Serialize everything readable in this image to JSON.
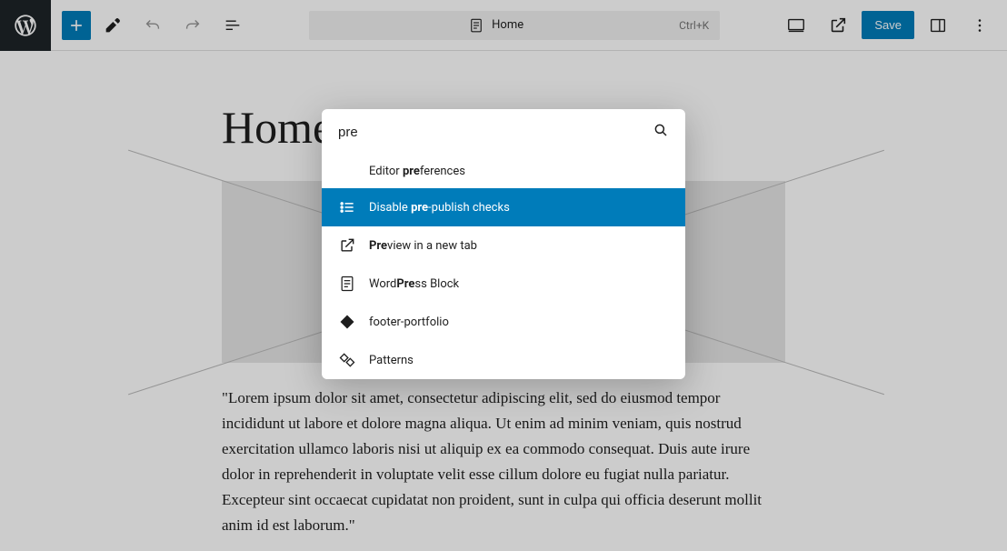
{
  "header": {
    "doc_title": "Home",
    "shortcut": "Ctrl+K",
    "save_label": "Save"
  },
  "page": {
    "title": "Home",
    "body": "\"Lorem ipsum dolor sit amet, consectetur adipiscing elit, sed do eiusmod tempor incididunt ut labore et dolore magna aliqua. Ut enim ad minim veniam, quis nostrud exercitation ullamco laboris nisi ut aliquip ex ea commodo consequat. Duis aute irure dolor in reprehenderit in voluptate velit esse cillum dolore eu fugiat nulla pariatur. Excepteur sint occaecat cupidatat non proident, sunt in culpa qui officia deserunt mollit anim id est laborum.\""
  },
  "palette": {
    "query": "pre",
    "items": [
      {
        "pre": "Editor ",
        "bold": "pre",
        "post": "ferences"
      },
      {
        "pre": "Disable ",
        "bold": "pre",
        "post": "-publish checks"
      },
      {
        "pre": "",
        "bold": "Pre",
        "post": "view in a new tab"
      },
      {
        "pre": "Word",
        "bold": "Pre",
        "post": "ss Block"
      },
      {
        "pre": "footer-portfolio",
        "bold": "",
        "post": ""
      },
      {
        "pre": "Patterns",
        "bold": "",
        "post": ""
      }
    ]
  }
}
